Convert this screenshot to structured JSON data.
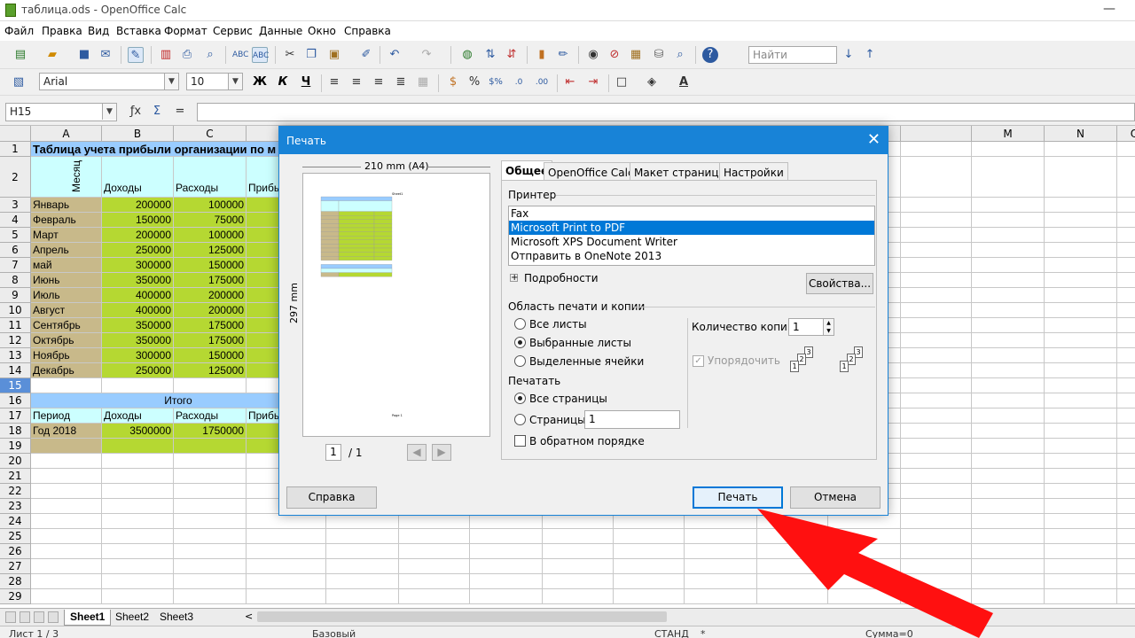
{
  "window": {
    "title": "таблица.ods - OpenOffice Calc"
  },
  "menu": [
    "Файл",
    "Правка",
    "Вид",
    "Вставка",
    "Формат",
    "Сервис",
    "Данные",
    "Окно",
    "Справка"
  ],
  "toolbar": {
    "find_placeholder": "Найти",
    "font_name": "Arial",
    "font_size": "10",
    "bold": "Ж",
    "italic": "К",
    "underline": "Ч"
  },
  "formula": {
    "cell_ref": "H15"
  },
  "columns": [
    "A",
    "B",
    "C",
    "",
    "",
    "",
    "",
    "",
    "",
    "",
    "",
    "",
    "",
    "M",
    "N",
    "O"
  ],
  "rows": [
    "1",
    "2",
    "3",
    "4",
    "5",
    "6",
    "7",
    "8",
    "9",
    "10",
    "11",
    "12",
    "13",
    "14",
    "15",
    "16",
    "17",
    "18",
    "19",
    "20",
    "21",
    "22",
    "23",
    "24",
    "25",
    "26",
    "27",
    "28",
    "29"
  ],
  "sheet": {
    "title": "Таблица учета прибыли организации по м",
    "header_month": "Месяц",
    "header_income": "Доходы",
    "header_expense": "Расходы",
    "header_profit": "Прибы",
    "months": [
      {
        "name": "Январь",
        "income": "200000",
        "expense": "100000"
      },
      {
        "name": "Февраль",
        "income": "150000",
        "expense": "75000"
      },
      {
        "name": "Март",
        "income": "200000",
        "expense": "100000"
      },
      {
        "name": "Апрель",
        "income": "250000",
        "expense": "125000"
      },
      {
        "name": "май",
        "income": "300000",
        "expense": "150000"
      },
      {
        "name": "Июнь",
        "income": "350000",
        "expense": "175000"
      },
      {
        "name": "Июль",
        "income": "400000",
        "expense": "200000"
      },
      {
        "name": "Август",
        "income": "400000",
        "expense": "200000"
      },
      {
        "name": "Сентябрь",
        "income": "350000",
        "expense": "175000"
      },
      {
        "name": "Октябрь",
        "income": "350000",
        "expense": "175000"
      },
      {
        "name": "Ноябрь",
        "income": "300000",
        "expense": "150000"
      },
      {
        "name": "Декабрь",
        "income": "250000",
        "expense": "125000"
      }
    ],
    "total_label": "Итого",
    "period_label": "Период",
    "period_income": "Доходы",
    "period_expense": "Расходы",
    "period_profit": "Прибы",
    "year_label": "Год 2018",
    "year_income": "3500000",
    "year_expense": "1750000"
  },
  "sheet_tabs": [
    "Sheet1",
    "Sheet2",
    "Sheet3"
  ],
  "status": {
    "page": "Лист 1 / 3",
    "style": "Базовый",
    "mode": "СТАНД",
    "modified": "*",
    "sum": "Сумма=0"
  },
  "dialog": {
    "title": "Печать",
    "paper_width": "210 mm (A4)",
    "paper_height": "297 mm",
    "page_current": "1",
    "page_total": "/ 1",
    "tabs": [
      "Общее",
      "OpenOffice Calc",
      "Макет страницы",
      "Настройки"
    ],
    "printer_group": "Принтер",
    "printers": [
      "Fax",
      "Microsoft Print to PDF",
      "Microsoft XPS Document Writer",
      "Отправить в OneNote 2013"
    ],
    "details": "Подробности",
    "properties_button": "Свойства...",
    "area_group": "Область печати и копии",
    "all_sheets": "Все листы",
    "selected_sheets": "Выбранные листы",
    "selected_cells": "Выделенные ячейки",
    "print_label": "Печатать",
    "all_pages": "Все страницы",
    "pages": "Страницы",
    "pages_value": "1",
    "reverse": "В обратном порядке",
    "copies_label": "Количество копий",
    "copies_value": "1",
    "collate": "Упорядочить",
    "help_button": "Справка",
    "print_button": "Печать",
    "cancel_button": "Отмена",
    "preview_sheet_label": "Sheet1",
    "preview_page_label": "Page 1"
  },
  "colors": {
    "accent": "#1883d7",
    "highlight_red": "#ff1010",
    "cell_blue": "#99ccff",
    "cell_tan": "#c8b98a",
    "cell_green": "#b5d832",
    "cell_cyan": "#ccffff"
  }
}
